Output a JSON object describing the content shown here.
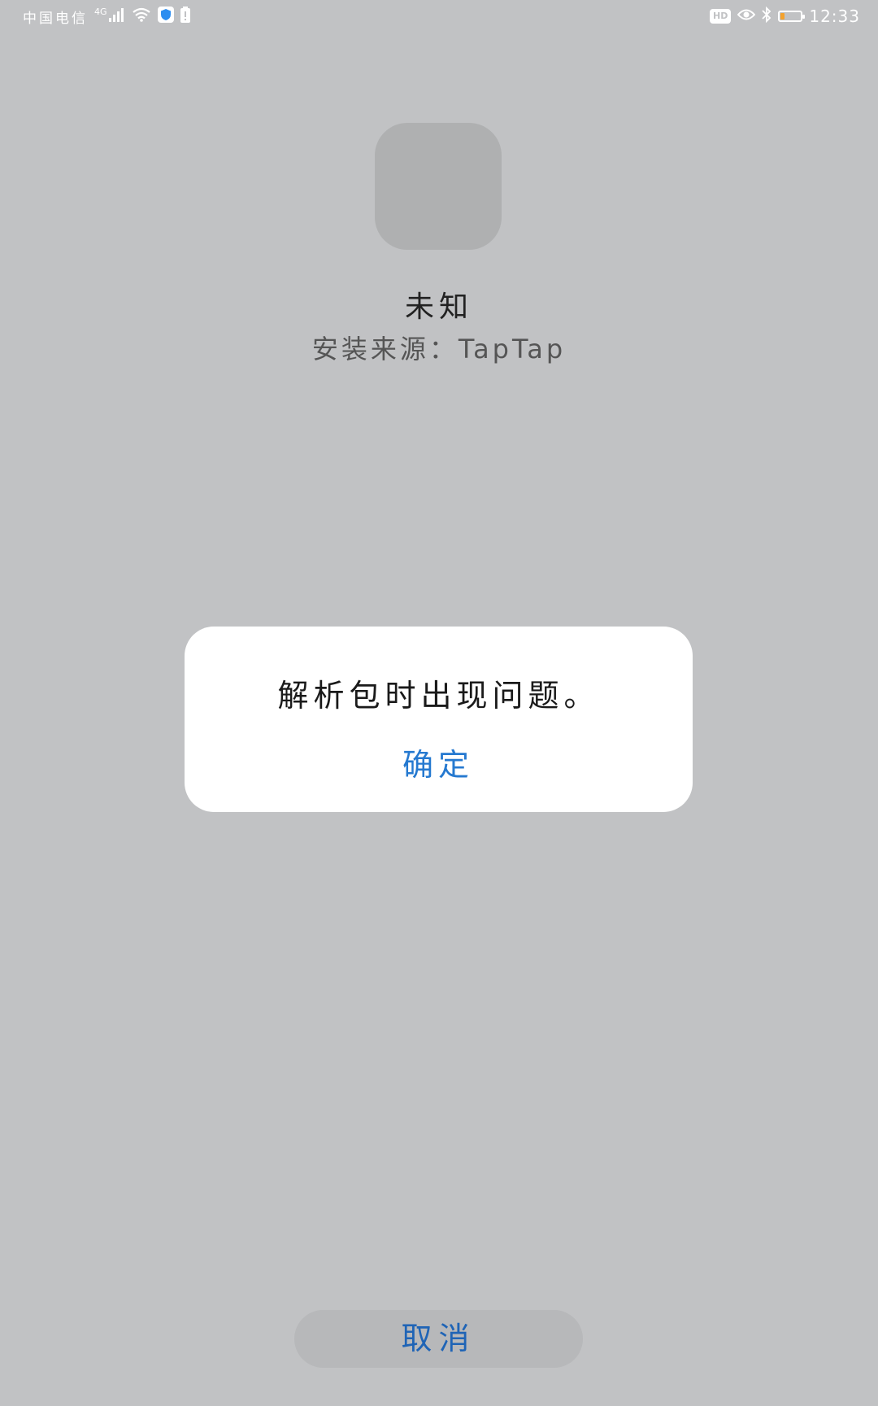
{
  "status_bar": {
    "carrier": "中国电信",
    "network_type": "4G",
    "time": "12:33",
    "hd_label": "HD",
    "battery_level": 0.2,
    "icons": [
      "signal-icon",
      "wifi-icon",
      "shield-icon",
      "battery-alert-icon",
      "hd-icon",
      "eye-icon",
      "bluetooth-icon",
      "battery-icon"
    ],
    "battery_color": "#f4a22d"
  },
  "app": {
    "name": "未知",
    "install_source": "安装来源：TapTap"
  },
  "dialog": {
    "message": "解析包时出现问题。",
    "confirm_label": "确定"
  },
  "footer": {
    "cancel_label": "取消"
  },
  "colors": {
    "background": "#c1c2c4",
    "accent": "#2579d0",
    "dialog_background": "#ffffff"
  }
}
